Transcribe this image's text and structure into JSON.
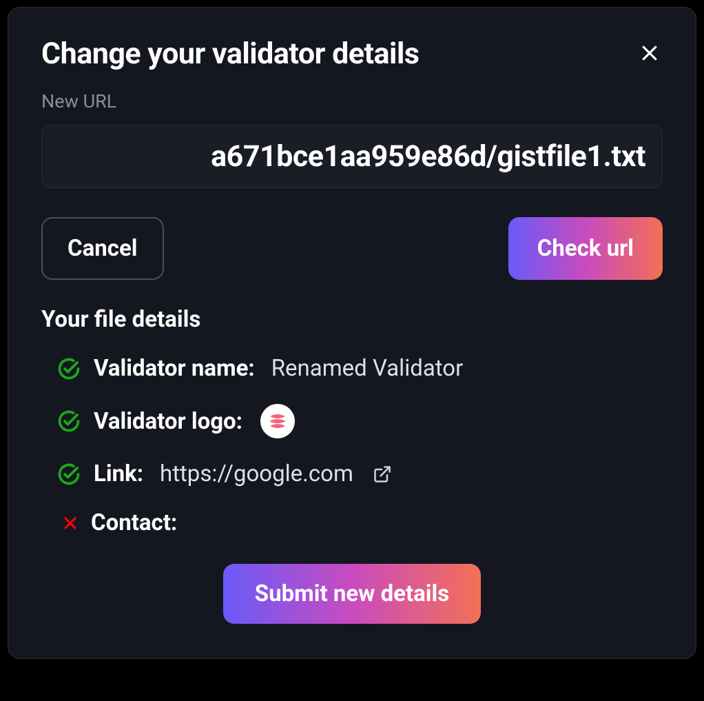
{
  "modal": {
    "title": "Change your validator details",
    "url_label": "New URL",
    "url_value": "a671bce1aa959e86d/gistfile1.txt",
    "cancel_label": "Cancel",
    "check_label": "Check url",
    "section_title": "Your file details",
    "submit_label": "Submit new details"
  },
  "details": {
    "name_label": "Validator name:",
    "name_value": "Renamed Validator",
    "name_status": "success",
    "logo_label": "Validator logo:",
    "logo_status": "success",
    "link_label": "Link:",
    "link_value": "https://google.com",
    "link_status": "success",
    "contact_label": "Contact:",
    "contact_value": "",
    "contact_status": "error"
  },
  "colors": {
    "success": "#1ba81b",
    "error": "#ff0000",
    "gradient_start": "#6a5af9",
    "gradient_mid": "#c94bbe",
    "gradient_end": "#f37055"
  }
}
